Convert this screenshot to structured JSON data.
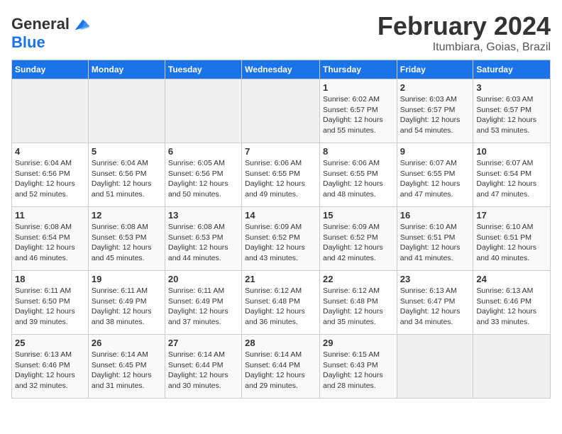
{
  "header": {
    "logo_line1": "General",
    "logo_line2": "Blue",
    "month_title": "February 2024",
    "subtitle": "Itumbiara, Goias, Brazil"
  },
  "days_of_week": [
    "Sunday",
    "Monday",
    "Tuesday",
    "Wednesday",
    "Thursday",
    "Friday",
    "Saturday"
  ],
  "weeks": [
    [
      {
        "day": "",
        "empty": true
      },
      {
        "day": "",
        "empty": true
      },
      {
        "day": "",
        "empty": true
      },
      {
        "day": "",
        "empty": true
      },
      {
        "day": "1",
        "sunrise": "6:02 AM",
        "sunset": "6:57 PM",
        "daylight": "12 hours and 55 minutes."
      },
      {
        "day": "2",
        "sunrise": "6:03 AM",
        "sunset": "6:57 PM",
        "daylight": "12 hours and 54 minutes."
      },
      {
        "day": "3",
        "sunrise": "6:03 AM",
        "sunset": "6:57 PM",
        "daylight": "12 hours and 53 minutes."
      }
    ],
    [
      {
        "day": "4",
        "sunrise": "6:04 AM",
        "sunset": "6:56 PM",
        "daylight": "12 hours and 52 minutes."
      },
      {
        "day": "5",
        "sunrise": "6:04 AM",
        "sunset": "6:56 PM",
        "daylight": "12 hours and 51 minutes."
      },
      {
        "day": "6",
        "sunrise": "6:05 AM",
        "sunset": "6:56 PM",
        "daylight": "12 hours and 50 minutes."
      },
      {
        "day": "7",
        "sunrise": "6:06 AM",
        "sunset": "6:55 PM",
        "daylight": "12 hours and 49 minutes."
      },
      {
        "day": "8",
        "sunrise": "6:06 AM",
        "sunset": "6:55 PM",
        "daylight": "12 hours and 48 minutes."
      },
      {
        "day": "9",
        "sunrise": "6:07 AM",
        "sunset": "6:55 PM",
        "daylight": "12 hours and 47 minutes."
      },
      {
        "day": "10",
        "sunrise": "6:07 AM",
        "sunset": "6:54 PM",
        "daylight": "12 hours and 47 minutes."
      }
    ],
    [
      {
        "day": "11",
        "sunrise": "6:08 AM",
        "sunset": "6:54 PM",
        "daylight": "12 hours and 46 minutes."
      },
      {
        "day": "12",
        "sunrise": "6:08 AM",
        "sunset": "6:53 PM",
        "daylight": "12 hours and 45 minutes."
      },
      {
        "day": "13",
        "sunrise": "6:08 AM",
        "sunset": "6:53 PM",
        "daylight": "12 hours and 44 minutes."
      },
      {
        "day": "14",
        "sunrise": "6:09 AM",
        "sunset": "6:52 PM",
        "daylight": "12 hours and 43 minutes."
      },
      {
        "day": "15",
        "sunrise": "6:09 AM",
        "sunset": "6:52 PM",
        "daylight": "12 hours and 42 minutes."
      },
      {
        "day": "16",
        "sunrise": "6:10 AM",
        "sunset": "6:51 PM",
        "daylight": "12 hours and 41 minutes."
      },
      {
        "day": "17",
        "sunrise": "6:10 AM",
        "sunset": "6:51 PM",
        "daylight": "12 hours and 40 minutes."
      }
    ],
    [
      {
        "day": "18",
        "sunrise": "6:11 AM",
        "sunset": "6:50 PM",
        "daylight": "12 hours and 39 minutes."
      },
      {
        "day": "19",
        "sunrise": "6:11 AM",
        "sunset": "6:49 PM",
        "daylight": "12 hours and 38 minutes."
      },
      {
        "day": "20",
        "sunrise": "6:11 AM",
        "sunset": "6:49 PM",
        "daylight": "12 hours and 37 minutes."
      },
      {
        "day": "21",
        "sunrise": "6:12 AM",
        "sunset": "6:48 PM",
        "daylight": "12 hours and 36 minutes."
      },
      {
        "day": "22",
        "sunrise": "6:12 AM",
        "sunset": "6:48 PM",
        "daylight": "12 hours and 35 minutes."
      },
      {
        "day": "23",
        "sunrise": "6:13 AM",
        "sunset": "6:47 PM",
        "daylight": "12 hours and 34 minutes."
      },
      {
        "day": "24",
        "sunrise": "6:13 AM",
        "sunset": "6:46 PM",
        "daylight": "12 hours and 33 minutes."
      }
    ],
    [
      {
        "day": "25",
        "sunrise": "6:13 AM",
        "sunset": "6:46 PM",
        "daylight": "12 hours and 32 minutes."
      },
      {
        "day": "26",
        "sunrise": "6:14 AM",
        "sunset": "6:45 PM",
        "daylight": "12 hours and 31 minutes."
      },
      {
        "day": "27",
        "sunrise": "6:14 AM",
        "sunset": "6:44 PM",
        "daylight": "12 hours and 30 minutes."
      },
      {
        "day": "28",
        "sunrise": "6:14 AM",
        "sunset": "6:44 PM",
        "daylight": "12 hours and 29 minutes."
      },
      {
        "day": "29",
        "sunrise": "6:15 AM",
        "sunset": "6:43 PM",
        "daylight": "12 hours and 28 minutes."
      },
      {
        "day": "",
        "empty": true
      },
      {
        "day": "",
        "empty": true
      }
    ]
  ]
}
